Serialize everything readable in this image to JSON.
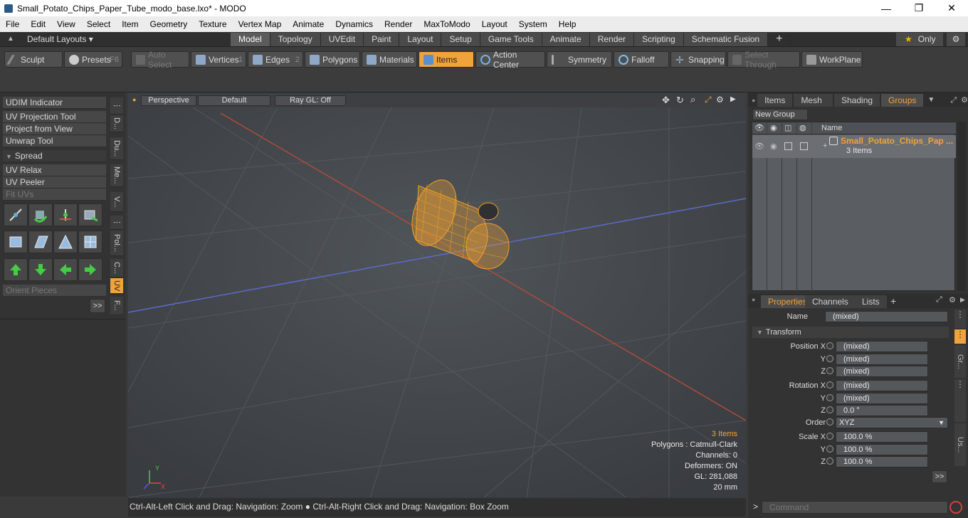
{
  "window": {
    "title": "Small_Potato_Chips_Paper_Tube_modo_base.lxo* - MODO",
    "minimize": "—",
    "restore": "❐",
    "close": "✕"
  },
  "menu": [
    "File",
    "Edit",
    "View",
    "Select",
    "Item",
    "Geometry",
    "Texture",
    "Vertex Map",
    "Animate",
    "Dynamics",
    "Render",
    "MaxToModo",
    "Layout",
    "System",
    "Help"
  ],
  "layouts": {
    "label": "Default Layouts ▾",
    "tabs": [
      "Model",
      "Topology",
      "UVEdit",
      "Paint",
      "Layout",
      "Setup",
      "Game Tools",
      "Animate",
      "Render",
      "Scripting",
      "Schematic Fusion"
    ],
    "active": "Model",
    "plus": "+",
    "only": "Only",
    "gear": "⚙"
  },
  "toolbar": {
    "sculpt": "Sculpt",
    "presets": "Presets",
    "presets_key": "F6",
    "auto_select": "Auto Select",
    "vertices": "Vertices",
    "vertices_n": "1",
    "edges": "Edges",
    "edges_n": "2",
    "polygons": "Polygons",
    "materials": "Materials",
    "items": "Items",
    "action_center": "Action Center",
    "symmetry": "Symmetry",
    "falloff": "Falloff",
    "snapping": "Snapping",
    "select_through": "Select Through",
    "workplane": "WorkPlane"
  },
  "left": {
    "items": [
      "UDIM Indicator",
      "UV Projection Tool",
      "Project from View",
      "Unwrap Tool"
    ],
    "spread": "Spread",
    "items2": [
      "UV Relax",
      "UV Peeler"
    ],
    "fit_uvs": "Fit UVs",
    "orient": "Orient Pieces",
    "more": ">>",
    "vtabs": [
      "D...",
      "Du...",
      "Me...",
      "V...",
      "Pol...",
      "C...",
      "UV",
      "F..."
    ]
  },
  "viewport": {
    "perspective": "Perspective",
    "shading": "Default",
    "raygl": "Ray GL: Off",
    "stats": {
      "items": "3 Items",
      "polygons": "Polygons : Catmull-Clark",
      "channels": "Channels: 0",
      "deformers": "Deformers: ON",
      "gl": "GL: 281,088",
      "size": "20 mm"
    }
  },
  "status": "Ctrl-Alt-Left Click and Drag: Navigation: Zoom ● Ctrl-Alt-Right Click and Drag: Navigation: Box Zoom",
  "right": {
    "tabs": [
      "Items",
      "Mesh ...",
      "Shading",
      "Groups"
    ],
    "active_tab": "Groups",
    "new_group": "New Group",
    "col_name": "Name",
    "group_name": "Small_Potato_Chips_Pap ...",
    "group_count": "3 Items",
    "prop_tabs": [
      "Properties",
      "Channels",
      "Lists"
    ],
    "plus": "+",
    "name_label": "Name",
    "name_value": "(mixed)",
    "transform": "Transform",
    "position_x": "Position X",
    "y": "Y",
    "z": "Z",
    "pos": [
      "(mixed)",
      "(mixed)",
      "(mixed)"
    ],
    "rotation_x": "Rotation X",
    "rot": [
      "(mixed)",
      "(mixed)",
      "0.0 °"
    ],
    "order_label": "Order",
    "order": "XYZ",
    "scale_x": "Scale X",
    "scale": [
      "100.0 %",
      "100.0 %",
      "100.0 %"
    ],
    "vtabs": [
      "Gr...",
      "Us..."
    ],
    "more": ">>"
  },
  "command": {
    "prompt": ">",
    "placeholder": "Command"
  },
  "colors": {
    "accent": "#f0a33a",
    "viewport": "#4a4e52",
    "mesh": "#f5a020"
  }
}
